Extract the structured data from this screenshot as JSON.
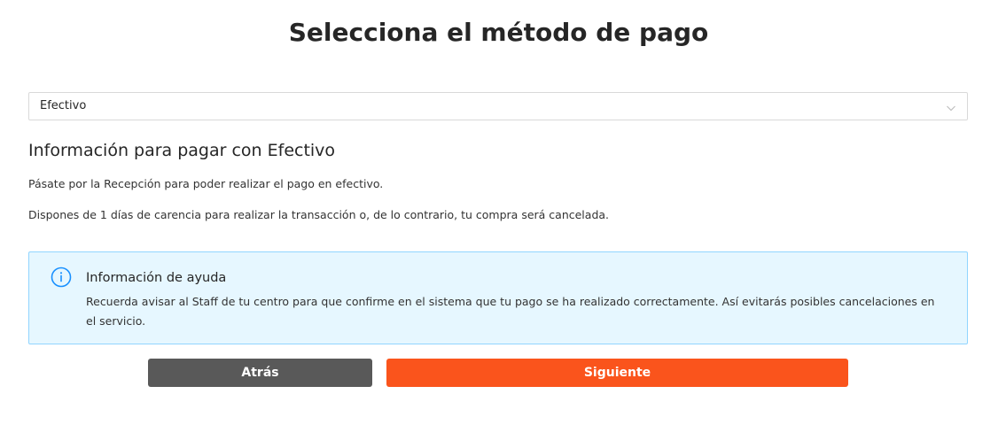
{
  "header": {
    "title": "Selecciona el método de pago"
  },
  "payment_select": {
    "selected": "Efectivo",
    "arrow_icon": "chevron-down-icon"
  },
  "info": {
    "title": "Información para pagar con Efectivo",
    "paragraph_1": "Pásate por la Recepción para poder realizar el pago en efectivo.",
    "paragraph_2": "Dispones de 1 días de carencia para realizar la transacción o, de lo contrario, tu compra será cancelada."
  },
  "help_alert": {
    "icon": "info-circle-icon",
    "title": "Información de ayuda",
    "description": "Recuerda avisar al Staff de tu centro para que confirme en el sistema que tu pago se ha realizado correctamente. Así evitarás posibles cancelaciones en el servicio.",
    "background_color": "#e6f7ff",
    "border_color": "#91d5ff",
    "icon_color": "#1890ff"
  },
  "actions": {
    "back_label": "Atrás",
    "next_label": "Siguiente",
    "back_color": "#595959",
    "next_color": "#fa541c"
  }
}
